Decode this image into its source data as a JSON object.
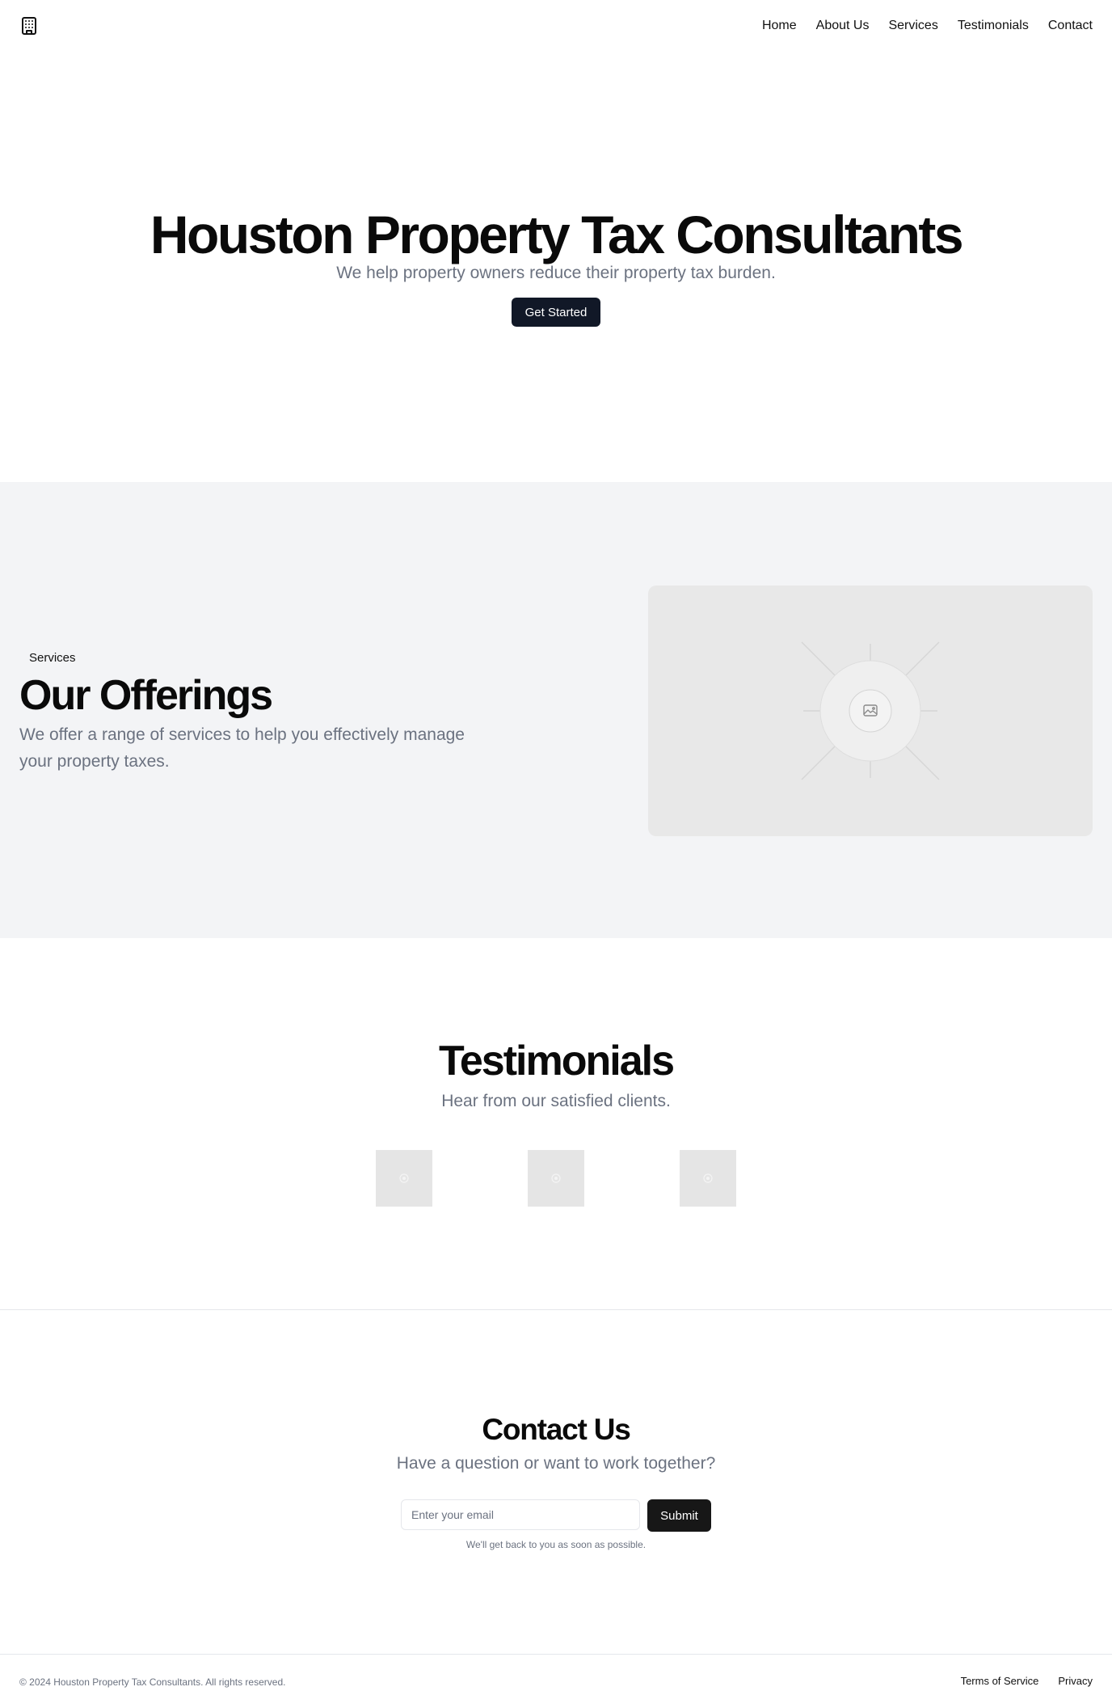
{
  "header": {
    "logo_icon": "building-icon",
    "nav": [
      "Home",
      "About Us",
      "Services",
      "Testimonials",
      "Contact"
    ]
  },
  "hero": {
    "title": "Houston Property Tax Consultants",
    "subtitle": "We help property owners reduce their property tax burden.",
    "cta_label": "Get Started"
  },
  "services": {
    "badge": "Services",
    "title": "Our Offerings",
    "description": "We offer a range of services to help you effectively manage your property taxes.",
    "image_icon": "image-placeholder-icon"
  },
  "testimonials": {
    "title": "Testimonials",
    "subtitle": "Hear from our satisfied clients."
  },
  "contact": {
    "title": "Contact Us",
    "subtitle": "Have a question or want to work together?",
    "email_placeholder": "Enter your email",
    "submit_label": "Submit",
    "note": "We'll get back to you as soon as possible."
  },
  "footer": {
    "copyright": "© 2024 Houston Property Tax Consultants. All rights reserved.",
    "links": [
      "Terms of Service",
      "Privacy"
    ]
  },
  "colors": {
    "primary_button": "#111827",
    "muted_text": "#6b7280",
    "section_bg": "#f3f4f6",
    "placeholder_bg": "#e8e8e8"
  }
}
